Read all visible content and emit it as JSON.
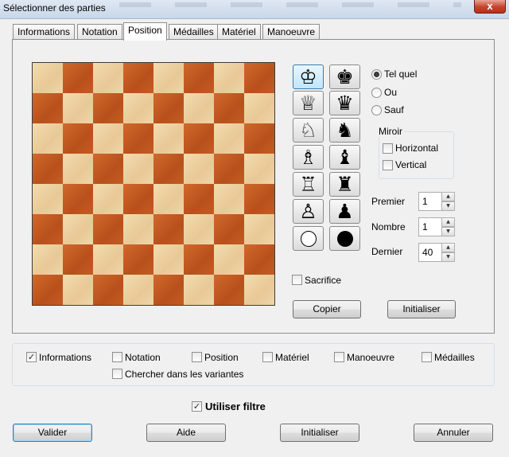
{
  "window": {
    "title": "Sélectionner des parties",
    "close_symbol": "x"
  },
  "tabs": [
    {
      "label": "Informations"
    },
    {
      "label": "Notation"
    },
    {
      "label": "Position",
      "active": true
    },
    {
      "label": "Médailles"
    },
    {
      "label": "Matériel"
    },
    {
      "label": "Manoeuvre"
    }
  ],
  "board": {
    "light_color": "#ecd09f",
    "dark_color": "#c15a22",
    "pieces": []
  },
  "piece_buttons": {
    "white": [
      {
        "icon": "white-king-icon",
        "glyph": "♔",
        "selected": true
      },
      {
        "icon": "white-queen-icon",
        "glyph": "♕"
      },
      {
        "icon": "white-knight-icon",
        "glyph": "♘"
      },
      {
        "icon": "white-bishop-icon",
        "glyph": "♗"
      },
      {
        "icon": "white-rook-icon",
        "glyph": "♖"
      },
      {
        "icon": "white-pawn-icon",
        "glyph": "♙"
      },
      {
        "icon": "white-circle-icon"
      }
    ],
    "black": [
      {
        "icon": "black-king-icon",
        "glyph": "♚"
      },
      {
        "icon": "black-queen-icon",
        "glyph": "♛"
      },
      {
        "icon": "black-knight-icon",
        "glyph": "♞"
      },
      {
        "icon": "black-bishop-icon",
        "glyph": "♝"
      },
      {
        "icon": "black-rook-icon",
        "glyph": "♜"
      },
      {
        "icon": "black-pawn-icon",
        "glyph": "♟"
      },
      {
        "icon": "black-circle-icon"
      }
    ]
  },
  "match_mode": {
    "options": [
      {
        "label": "Tel quel",
        "selected": true
      },
      {
        "label": "Ou",
        "selected": false
      },
      {
        "label": "Sauf",
        "selected": false
      }
    ]
  },
  "mirror": {
    "legend": "Miroir",
    "horizontal": {
      "label": "Horizontal",
      "checked": false
    },
    "vertical": {
      "label": "Vertical",
      "checked": false
    }
  },
  "spinners": {
    "premier": {
      "label": "Premier",
      "value": "1"
    },
    "nombre": {
      "label": "Nombre",
      "value": "1"
    },
    "dernier": {
      "label": "Dernier",
      "value": "40"
    }
  },
  "sacrifice": {
    "label": "Sacrifice",
    "checked": false
  },
  "position_buttons": {
    "copier": "Copier",
    "initialiser": "Initialiser"
  },
  "criteria": {
    "informations": {
      "label": "Informations",
      "checked": true
    },
    "notation": {
      "label": "Notation",
      "checked": false
    },
    "position": {
      "label": "Position",
      "checked": false
    },
    "materiel": {
      "label": "Matériel",
      "checked": false
    },
    "manoeuvre": {
      "label": "Manoeuvre",
      "checked": false
    },
    "medailles": {
      "label": "Médailles",
      "checked": false
    },
    "variantes": {
      "label": "Chercher dans les variantes",
      "checked": false
    }
  },
  "filter": {
    "label": "Utiliser filtre",
    "checked": true
  },
  "footer": {
    "valider": "Valider",
    "aide": "Aide",
    "initialiser": "Initialiser",
    "annuler": "Annuler"
  },
  "check_mark": "✓"
}
